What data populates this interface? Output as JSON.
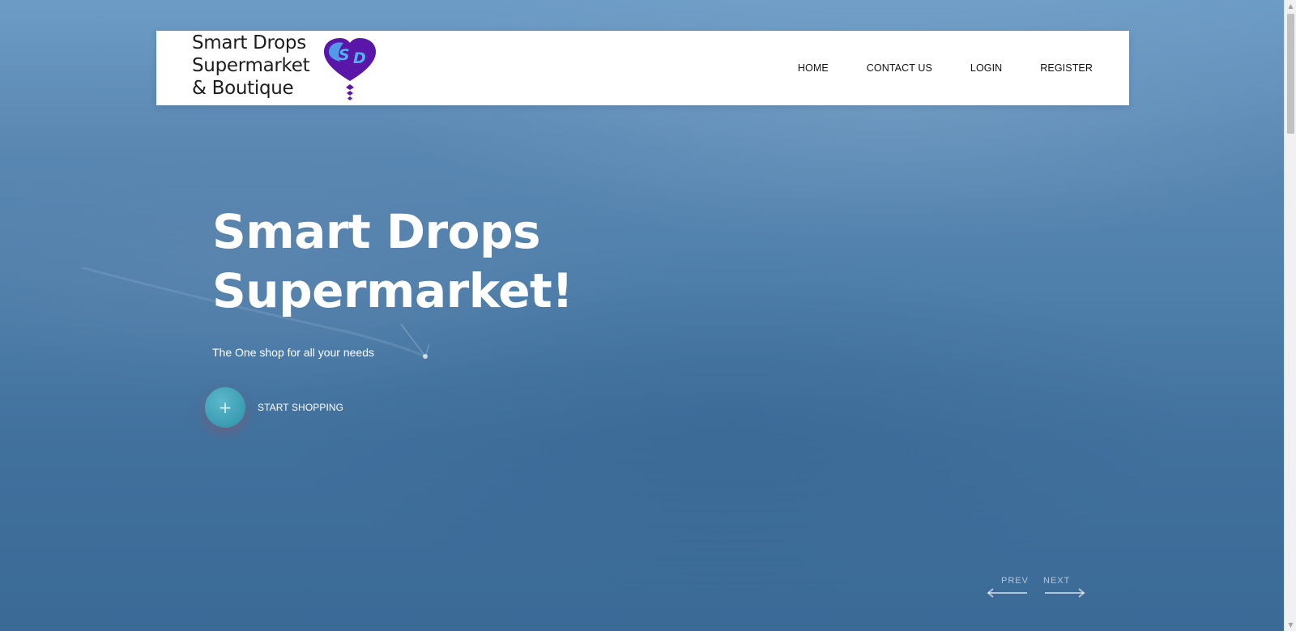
{
  "brand": {
    "lines": [
      "Smart Drops",
      "Supermarket",
      "& Boutique"
    ],
    "logo_letters": "SD",
    "logo_colors": {
      "primary": "#5a16a8",
      "accent": "#4fb2f2"
    }
  },
  "nav": {
    "items": [
      {
        "label": "HOME"
      },
      {
        "label": "CONTACT US"
      },
      {
        "label": "LOGIN"
      },
      {
        "label": "REGISTER"
      }
    ]
  },
  "hero": {
    "title_lines": [
      "Smart Drops",
      "Supermarket!"
    ],
    "subtitle": "The One shop for all your needs",
    "cta": {
      "icon": "plus-icon",
      "label": "START SHOPPING"
    }
  },
  "slider": {
    "prev_label": "PREV",
    "next_label": "NEXT"
  },
  "colors": {
    "cta_circle": "#3a9cb3",
    "background": "#4a7aa6"
  }
}
